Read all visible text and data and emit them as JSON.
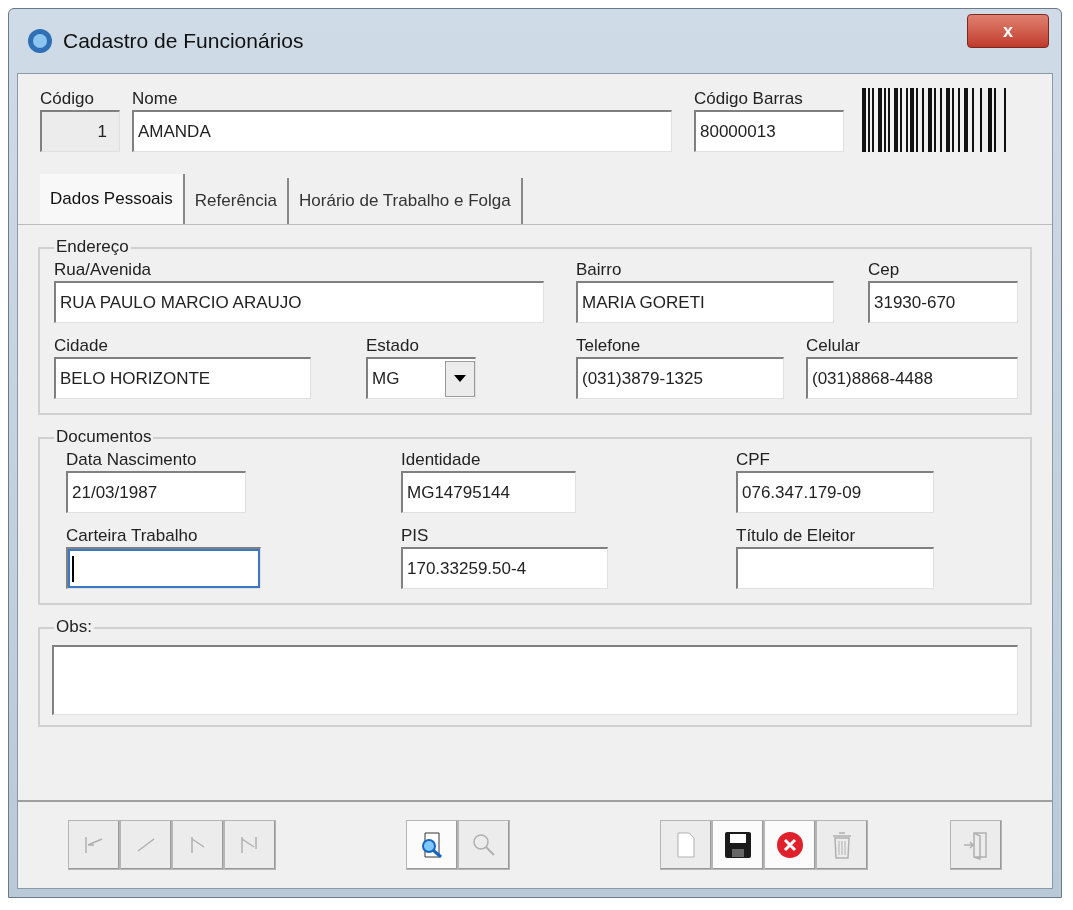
{
  "window": {
    "title": "Cadastro de Funcionários",
    "close": "x"
  },
  "header": [
    {
      "label": "Código",
      "value": "1",
      "disabled": true
    },
    {
      "label": "Nome",
      "value": "AMANDA",
      "disabled": false
    },
    {
      "label": "Código Barras",
      "value": "80000013",
      "disabled": false
    }
  ],
  "tabs": [
    {
      "label": "Dados Pessoais",
      "selected": true
    },
    {
      "label": "Referência",
      "selected": false
    },
    {
      "label": "Horário de Trabalho e Folga",
      "selected": false
    }
  ],
  "endereco": {
    "title": "Endereço",
    "fields": [
      {
        "label": "Rua/Avenida",
        "value": "RUA PAULO MARCIO ARAUJO",
        "kind": "text"
      },
      {
        "label": "Bairro",
        "value": "MARIA GORETI",
        "kind": "text"
      },
      {
        "label": "Cep",
        "value": "31930-670",
        "kind": "text"
      },
      {
        "label": "Cidade",
        "value": "BELO HORIZONTE",
        "kind": "text"
      },
      {
        "label": "Estado",
        "value": "MG",
        "kind": "dropdown"
      },
      {
        "label": "Telefone",
        "value": "(031)3879-1325",
        "kind": "text"
      },
      {
        "label": "Celular",
        "value": "(031)8868-4488",
        "kind": "text"
      }
    ]
  },
  "documentos": {
    "title": "Documentos",
    "fields": [
      {
        "label": "Data Nascimento",
        "value": "21/03/1987",
        "focused": false
      },
      {
        "label": "Identidade",
        "value": "MG14795144",
        "focused": false
      },
      {
        "label": "CPF",
        "value": "076.347.179-09",
        "focused": false
      },
      {
        "label": "Carteira Trabalho",
        "focused": true
      },
      {
        "label": "PIS",
        "value": "170.33259.50-4",
        "focused": false
      },
      {
        "label": "Título de Eleitor",
        "focused": false
      }
    ]
  },
  "obs": {
    "title": "Obs:"
  },
  "toolbar": [
    {
      "kind": "first",
      "disabled": true
    },
    {
      "kind": "prev",
      "disabled": true
    },
    {
      "kind": "next",
      "disabled": true
    },
    {
      "kind": "last",
      "disabled": true
    },
    {
      "kind": "find",
      "disabled": false
    },
    {
      "kind": "search",
      "disabled": true
    },
    {
      "kind": "new",
      "disabled": true
    },
    {
      "kind": "save",
      "disabled": false
    },
    {
      "kind": "cancel",
      "disabled": false
    },
    {
      "kind": "delete",
      "disabled": true
    },
    {
      "kind": "exit",
      "disabled": true
    }
  ]
}
